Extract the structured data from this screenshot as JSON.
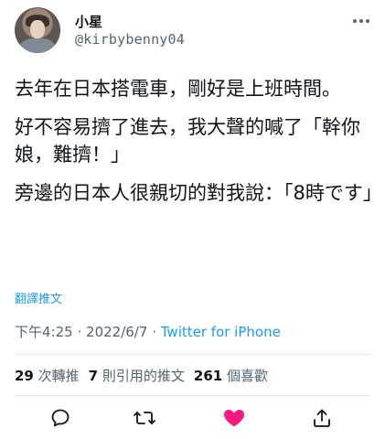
{
  "user": {
    "display_name": "小星",
    "handle": "@kirbybenny04"
  },
  "tweet": {
    "paragraphs": [
      "去年在日本搭電車，剛好是上班時間。",
      "好不容易擠了進去，我大聲的喊了「幹你娘，難擠！」",
      "旁邊的日本人很親切的對我說：「8時です」"
    ],
    "translate_label": "翻譯推文",
    "time": "下午4:25",
    "date": "2022/6/7",
    "separator": "·",
    "source": "Twitter for iPhone"
  },
  "stats": {
    "retweets_count": "29",
    "retweets_label": "次轉推",
    "quotes_count": "7",
    "quotes_label": "則引用的推文",
    "likes_count": "261",
    "likes_label": "個喜歡"
  },
  "icons": {
    "reply": "reply-icon",
    "retweet": "retweet-icon",
    "like": "heart-icon",
    "share": "share-icon"
  },
  "colors": {
    "accent": "#1d9bf0",
    "like": "#f91880",
    "secondary_text": "#536471",
    "primary_text": "#0f1419"
  }
}
